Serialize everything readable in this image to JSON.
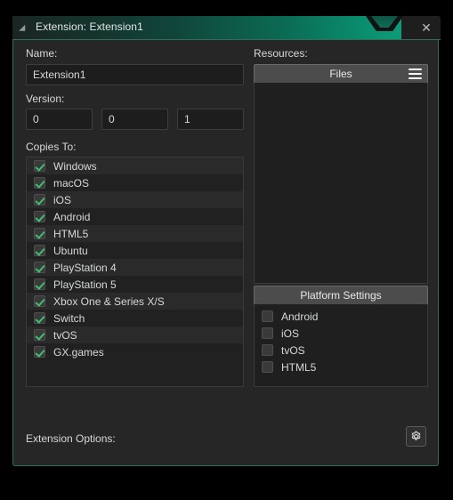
{
  "window": {
    "title": "Extension: Extension1",
    "collapse_icon": "triangle-collapse-icon",
    "close_label": "✕"
  },
  "left": {
    "name_label": "Name:",
    "name_value": "Extension1",
    "version_label": "Version:",
    "version_major": "0",
    "version_minor": "0",
    "version_build": "1",
    "copies_to_label": "Copies To:",
    "copies_to": [
      {
        "label": "Windows",
        "checked": true
      },
      {
        "label": "macOS",
        "checked": true
      },
      {
        "label": "iOS",
        "checked": true
      },
      {
        "label": "Android",
        "checked": true
      },
      {
        "label": "HTML5",
        "checked": true
      },
      {
        "label": "Ubuntu",
        "checked": true
      },
      {
        "label": "PlayStation 4",
        "checked": true
      },
      {
        "label": "PlayStation 5",
        "checked": true
      },
      {
        "label": "Xbox One & Series X/S",
        "checked": true
      },
      {
        "label": "Switch",
        "checked": true
      },
      {
        "label": "tvOS",
        "checked": true
      },
      {
        "label": "GX.games",
        "checked": true
      }
    ]
  },
  "right": {
    "resources_label": "Resources:",
    "files_header": "Files",
    "files_menu_icon": "hamburger-menu-icon",
    "files_items": [],
    "platform_settings_header": "Platform Settings",
    "platform_settings": [
      {
        "label": "Android",
        "checked": false
      },
      {
        "label": "iOS",
        "checked": false
      },
      {
        "label": "tvOS",
        "checked": false
      },
      {
        "label": "HTML5",
        "checked": false
      }
    ]
  },
  "footer": {
    "extension_options_label": "Extension Options:",
    "gear_icon": "gear-icon"
  },
  "colors": {
    "accent_teal": "#0d9c78",
    "border_green": "#2f6e5a",
    "panel_bg": "#262626",
    "list_bg": "#212121",
    "check_green": "#3fbd72",
    "header_gray": "#4c4c4c"
  }
}
